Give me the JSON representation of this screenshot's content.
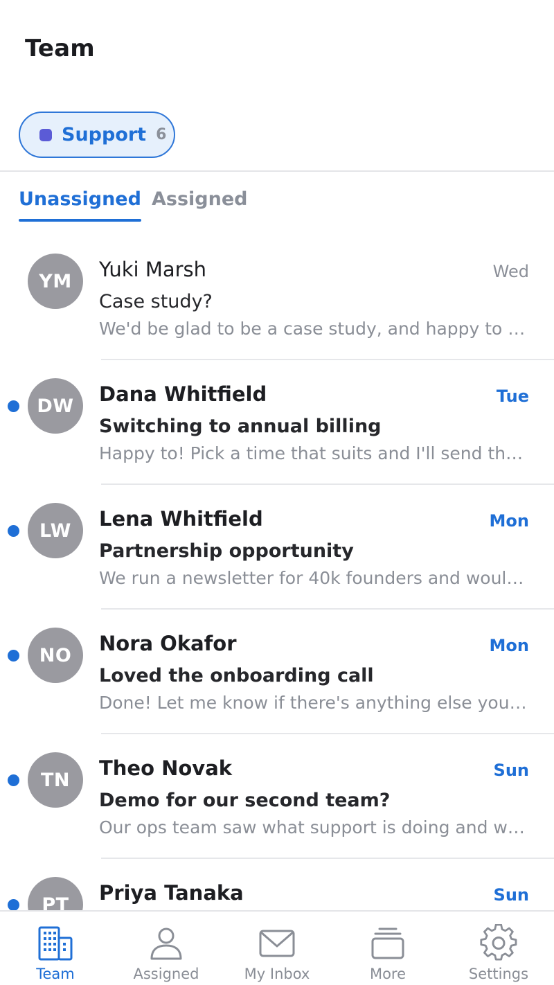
{
  "header": {
    "title": "Team"
  },
  "inbox_chip": {
    "label": "Support",
    "count": "6",
    "dot_color": "#5b5bd6"
  },
  "tabs": [
    {
      "label": "Unassigned",
      "active": true
    },
    {
      "label": "Assigned",
      "active": false
    }
  ],
  "conversations": [
    {
      "initials": "YM",
      "name": "Yuki Marsh",
      "time": "Wed",
      "subject": "Case study?",
      "preview": "We'd be glad to be a case study, and happy to s...",
      "unread": false
    },
    {
      "initials": "DW",
      "name": "Dana Whitfield",
      "time": "Tue",
      "subject": "Switching to annual billing",
      "preview": "Happy to! Pick a time that suits and I'll send the i...",
      "unread": true
    },
    {
      "initials": "LW",
      "name": "Lena Whitfield",
      "time": "Mon",
      "subject": "Partnership opportunity",
      "preview": "We run a newsletter for 40k founders and would ...",
      "unread": true
    },
    {
      "initials": "NO",
      "name": "Nora Okafor",
      "time": "Mon",
      "subject": "Loved the onboarding call",
      "preview": "Done! Let me know if there's anything else you n...",
      "unread": true
    },
    {
      "initials": "TN",
      "name": "Theo Novak",
      "time": "Sun",
      "subject": "Demo for our second team?",
      "preview": "Our ops team saw what support is doing and wa...",
      "unread": true
    },
    {
      "initials": "PT",
      "name": "Priya Tanaka",
      "time": "Sun",
      "subject": "",
      "preview": "",
      "unread": true
    }
  ],
  "tabbar": [
    {
      "label": "Team",
      "icon": "building-icon",
      "active": true
    },
    {
      "label": "Assigned",
      "icon": "person-icon",
      "active": false
    },
    {
      "label": "My Inbox",
      "icon": "envelope-icon",
      "active": false
    },
    {
      "label": "More",
      "icon": "stack-icon",
      "active": false
    },
    {
      "label": "Settings",
      "icon": "gear-icon",
      "active": false
    }
  ],
  "colors": {
    "accent": "#1f6fd6",
    "avatar": "#9a9aa0",
    "muted": "#8a8e96"
  }
}
